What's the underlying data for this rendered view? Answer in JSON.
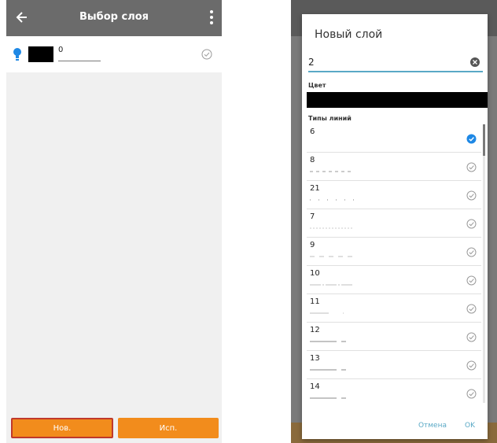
{
  "left_screen": {
    "header": {
      "title": "Выбор слоя"
    },
    "layer": {
      "name": "0"
    },
    "buttons": {
      "new_label": "Нов.",
      "use_label": "Исп."
    }
  },
  "dialog": {
    "title": "Новый слой",
    "name_value": "2",
    "color_label": "Цвет",
    "color_value": "#000000",
    "line_types_label": "Типы линий",
    "line_types": [
      {
        "number": "6",
        "selected": true
      },
      {
        "number": "8",
        "selected": false
      },
      {
        "number": "21",
        "selected": false
      },
      {
        "number": "7",
        "selected": false
      },
      {
        "number": "9",
        "selected": false
      },
      {
        "number": "10",
        "selected": false
      },
      {
        "number": "11",
        "selected": false
      },
      {
        "number": "12",
        "selected": false
      },
      {
        "number": "13",
        "selected": false
      },
      {
        "number": "14",
        "selected": false
      }
    ],
    "cancel_label": "Отмена",
    "ok_label": "OK"
  },
  "colors": {
    "accent": "#f28c1c",
    "header": "#6b6b6b",
    "link": "#5aa9c6",
    "bulb": "#1e88e5"
  },
  "icons": {
    "back": "arrow-left-icon",
    "menu": "more-vertical-icon",
    "bulb": "lightbulb-icon",
    "check": "check-circle-icon",
    "clear": "clear-icon"
  }
}
